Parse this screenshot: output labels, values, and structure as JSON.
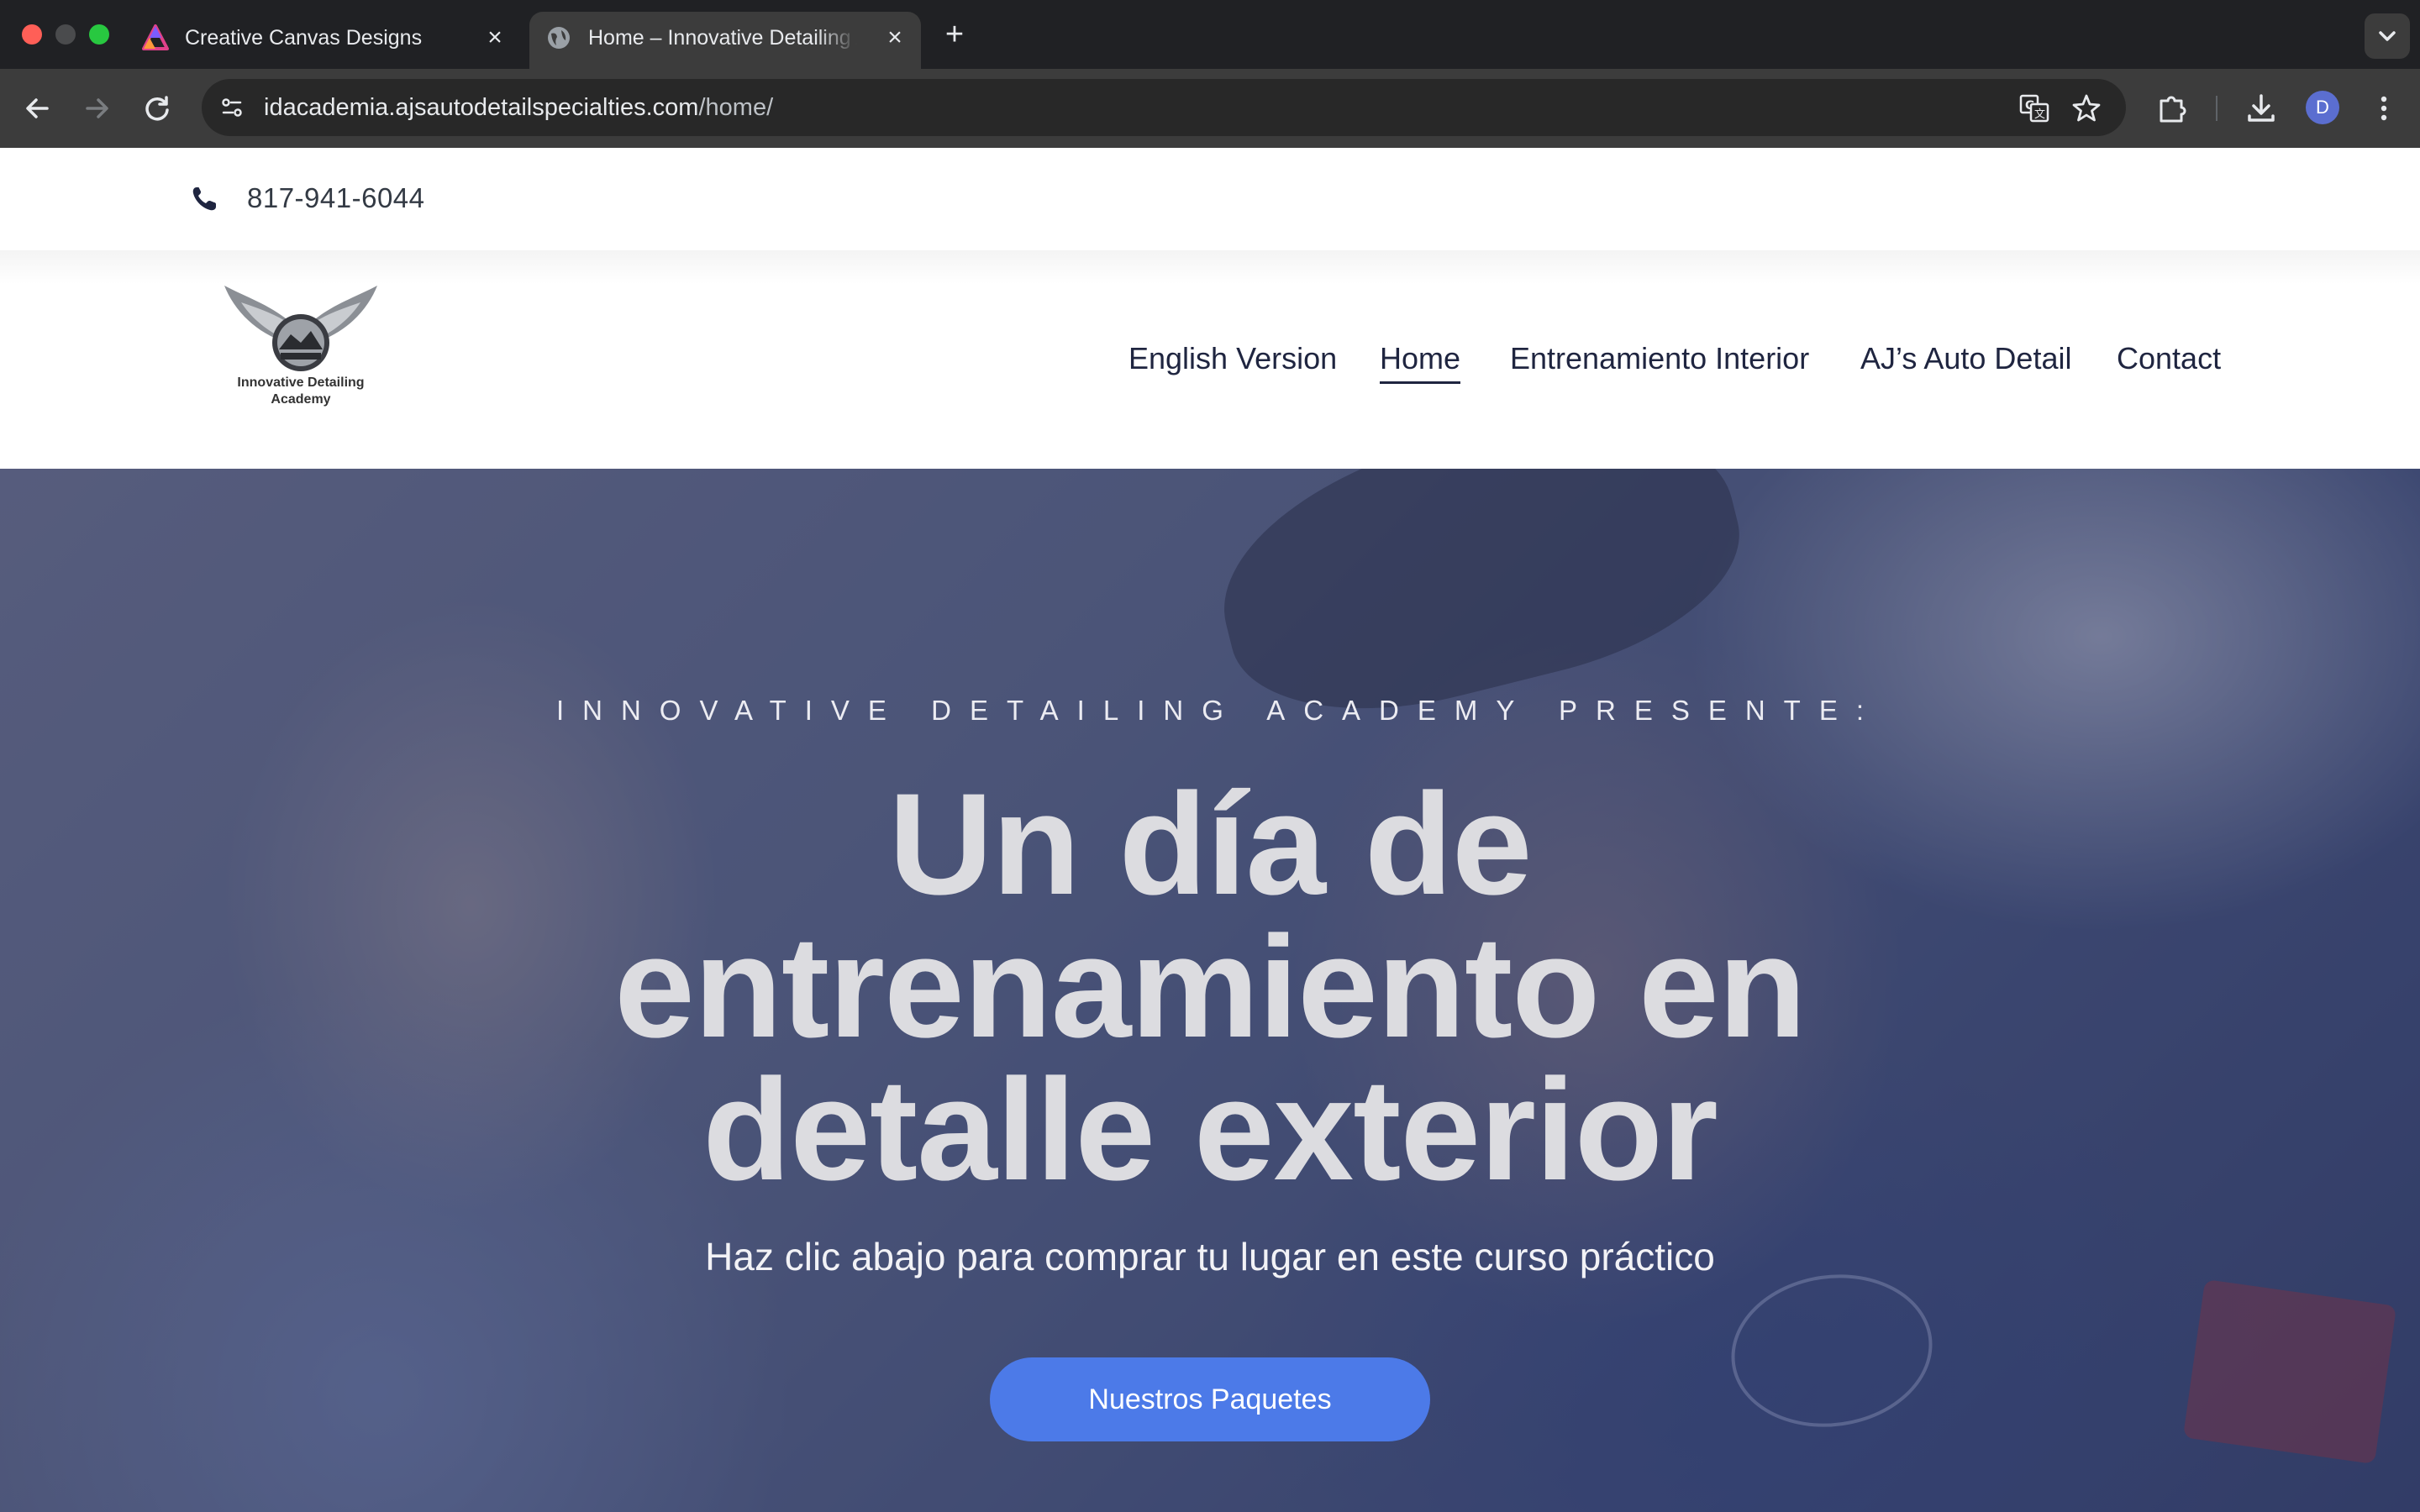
{
  "browser": {
    "tabs": [
      {
        "title": "Creative Canvas Designs",
        "favicon": "affinity-logo-icon",
        "active": false
      },
      {
        "title": "Home – Innovative Detailing Academy",
        "favicon": "globe-icon",
        "active": true
      }
    ],
    "url_host": "idacademia.ajsautodetailspecialties.com",
    "url_path": "/home/",
    "profile_initial": "D",
    "colors": {
      "tabbar": "#202124",
      "toolbar": "#3c3c3c",
      "omnibox": "#282828"
    }
  },
  "site": {
    "topbar": {
      "phone": "817-941-6044"
    },
    "logo": {
      "line1": "Innovative Detailing",
      "line2": "Academy"
    },
    "nav": [
      {
        "label": "English Version",
        "current": false
      },
      {
        "label": "Home",
        "current": true
      },
      {
        "label": "Entrenamiento Interior",
        "current": false
      },
      {
        "label": "AJ’s Auto Detail",
        "current": false
      },
      {
        "label": "Contact",
        "current": false
      }
    ],
    "hero": {
      "eyebrow": "INNOVATIVE DETAILING ACADEMY PRESENTE:",
      "headline_line1": "Un día de",
      "headline_line2": "entrenamiento en",
      "headline_line3": "detalle exterior",
      "subhead": "Haz clic abajo para comprar tu lugar en este curso práctico",
      "cta": "Nuestros Paquetes"
    },
    "colors": {
      "accent": "#4c7ae8",
      "nav_text": "#1f2540"
    }
  }
}
